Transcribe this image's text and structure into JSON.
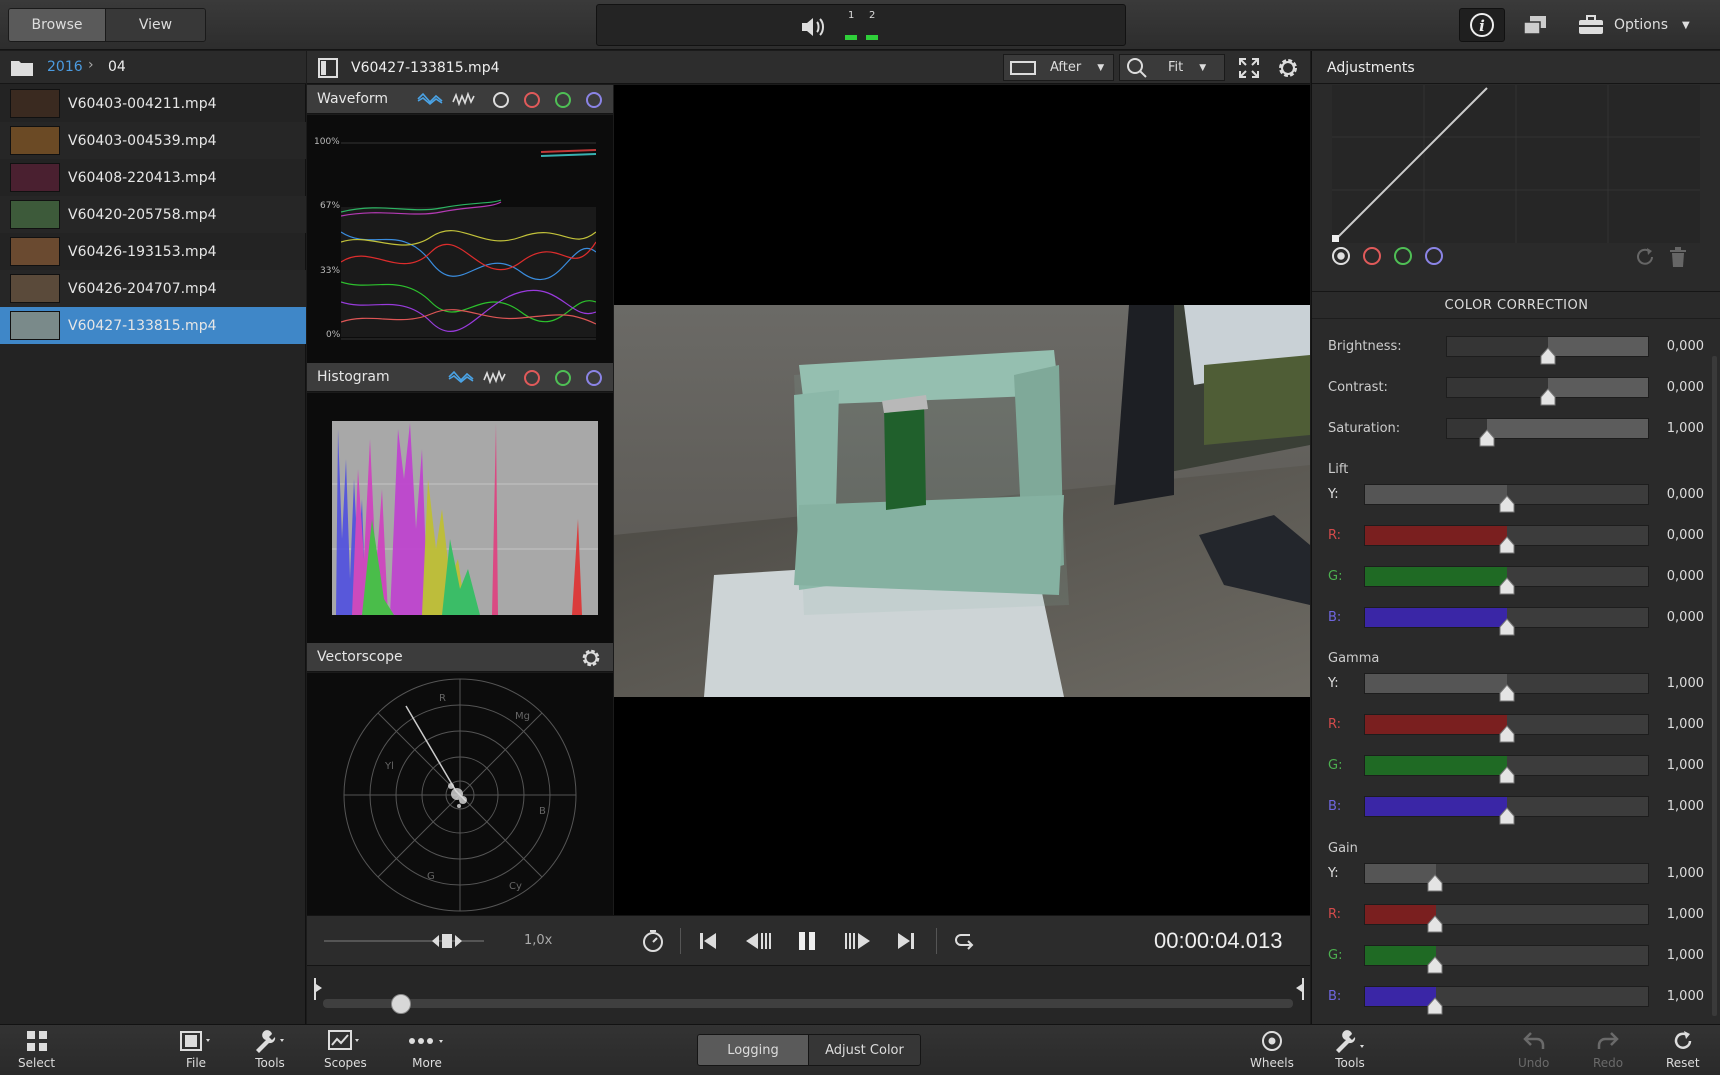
{
  "topbar": {
    "browse_label": "Browse",
    "view_label": "View",
    "meter_channels": [
      "1",
      "2"
    ],
    "options_label": "Options"
  },
  "browser": {
    "breadcrumb": [
      "2016",
      "04"
    ],
    "files": [
      {
        "name": "V60403-004211.mp4",
        "selected": false
      },
      {
        "name": "V60403-004539.mp4",
        "selected": false
      },
      {
        "name": "V60408-220413.mp4",
        "selected": false
      },
      {
        "name": "V60420-205758.mp4",
        "selected": false
      },
      {
        "name": "V60426-193153.mp4",
        "selected": false
      },
      {
        "name": "V60426-204707.mp4",
        "selected": false
      },
      {
        "name": "V60427-133815.mp4",
        "selected": true
      }
    ]
  },
  "viewer": {
    "clip_name": "V60427-133815.mp4",
    "compare_mode": "After",
    "zoom": "Fit"
  },
  "scopes": {
    "waveform": {
      "title": "Waveform",
      "ticks": [
        "100%",
        "67%",
        "33%",
        "0%"
      ]
    },
    "histogram": {
      "title": "Histogram"
    },
    "vectorscope": {
      "title": "Vectorscope",
      "labels": [
        "R",
        "Mg",
        "B",
        "Cy",
        "G",
        "Yl"
      ]
    }
  },
  "transport": {
    "speed": "1,0x",
    "timecode": "00:00:04.013",
    "playhead_fraction": 0.08
  },
  "adjustments": {
    "title": "Adjustments",
    "section_title": "COLOR CORRECTION",
    "basic": [
      {
        "label": "Brightness:",
        "value": "0,000",
        "level": 0.5
      },
      {
        "label": "Contrast:",
        "value": "0,000",
        "level": 0.5
      },
      {
        "label": "Saturation:",
        "value": "1,000",
        "level": 0.2
      }
    ],
    "groups": [
      {
        "title": "Lift",
        "rows": [
          {
            "label": "Y:",
            "value": "0,000",
            "level": 0.5,
            "color": "#555555",
            "label_color": "#dddddd"
          },
          {
            "label": "R:",
            "value": "0,000",
            "level": 0.5,
            "color": "#7a1f1f",
            "label_color": "#d24a4a"
          },
          {
            "label": "G:",
            "value": "0,000",
            "level": 0.5,
            "color": "#1f6a24",
            "label_color": "#4cb04f"
          },
          {
            "label": "B:",
            "value": "0,000",
            "level": 0.5,
            "color": "#3a26a6",
            "label_color": "#6f66e0"
          }
        ]
      },
      {
        "title": "Gamma",
        "rows": [
          {
            "label": "Y:",
            "value": "1,000",
            "level": 0.5,
            "color": "#555555",
            "label_color": "#dddddd"
          },
          {
            "label": "R:",
            "value": "1,000",
            "level": 0.5,
            "color": "#7a1f1f",
            "label_color": "#d24a4a"
          },
          {
            "label": "G:",
            "value": "1,000",
            "level": 0.5,
            "color": "#1f6a24",
            "label_color": "#4cb04f"
          },
          {
            "label": "B:",
            "value": "1,000",
            "level": 0.5,
            "color": "#3a26a6",
            "label_color": "#6f66e0"
          }
        ]
      },
      {
        "title": "Gain",
        "rows": [
          {
            "label": "Y:",
            "value": "1,000",
            "level": 0.25,
            "color": "#555555",
            "label_color": "#dddddd"
          },
          {
            "label": "R:",
            "value": "1,000",
            "level": 0.25,
            "color": "#7a1f1f",
            "label_color": "#d24a4a"
          },
          {
            "label": "G:",
            "value": "1,000",
            "level": 0.25,
            "color": "#1f6a24",
            "label_color": "#4cb04f"
          },
          {
            "label": "B:",
            "value": "1,000",
            "level": 0.25,
            "color": "#3a26a6",
            "label_color": "#6f66e0"
          }
        ]
      }
    ]
  },
  "bottombar": {
    "select": "Select",
    "file": "File",
    "tools": "Tools",
    "scopes": "Scopes",
    "more": "More",
    "logging": "Logging",
    "adjust_color": "Adjust Color",
    "wheels": "Wheels",
    "tools_right": "Tools",
    "undo": "Undo",
    "redo": "Redo",
    "reset": "Reset"
  },
  "colors": {
    "accent": "#3d86c6",
    "selection": "#3f87c8"
  }
}
